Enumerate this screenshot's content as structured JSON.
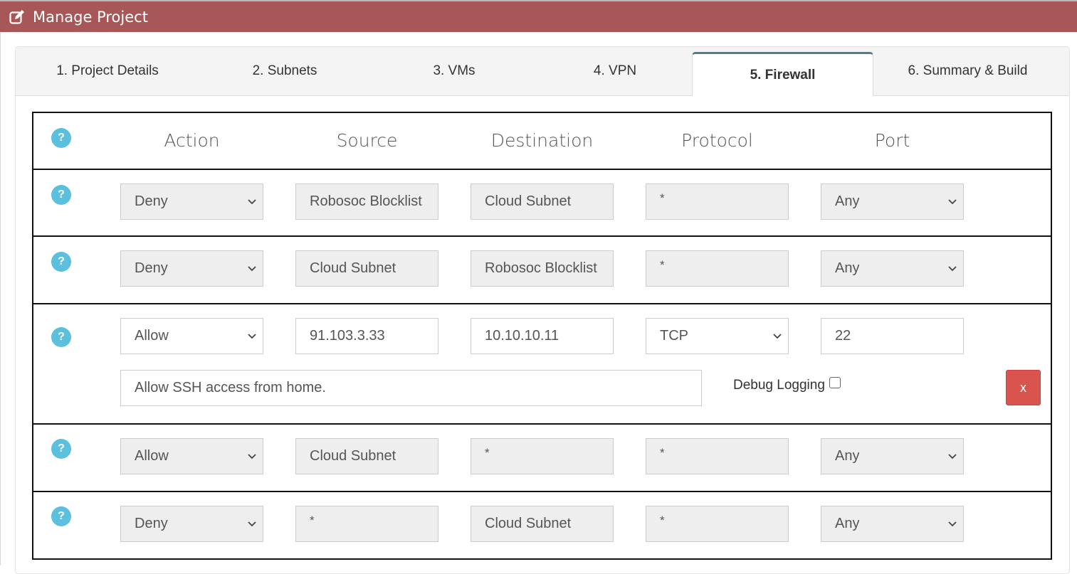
{
  "header": {
    "icon": "edit-icon",
    "title": "Manage Project"
  },
  "tabs": [
    {
      "label": "1. Project Details",
      "active": false
    },
    {
      "label": "2. Subnets",
      "active": false
    },
    {
      "label": "3. VMs",
      "active": false
    },
    {
      "label": "4. VPN",
      "active": false
    },
    {
      "label": "5. Firewall",
      "active": true
    },
    {
      "label": "6. Summary & Build",
      "active": false
    }
  ],
  "columns": [
    "Action",
    "Source",
    "Destination",
    "Protocol",
    "Port"
  ],
  "help_icon": "?",
  "rules": [
    {
      "action": "Deny",
      "source": "Robosoc Blocklist",
      "destination": "Cloud Subnet",
      "protocol": "*",
      "port": "Any",
      "editable": false
    },
    {
      "action": "Deny",
      "source": "Cloud Subnet",
      "destination": "Robosoc Blocklist",
      "protocol": "*",
      "port": "Any",
      "editable": false
    },
    {
      "action": "Allow",
      "source": "91.103.3.33",
      "destination": "10.10.10.11",
      "protocol": "TCP",
      "port": "22",
      "editable": true,
      "comment": "Allow SSH access from home.",
      "debug_label": "Debug Logging",
      "debug_checked": false,
      "delete_label": "x"
    },
    {
      "action": "Allow",
      "source": "Cloud Subnet",
      "destination": "*",
      "protocol": "*",
      "port": "Any",
      "editable": false
    },
    {
      "action": "Deny",
      "source": "*",
      "destination": "Cloud Subnet",
      "protocol": "*",
      "port": "Any",
      "editable": false
    }
  ],
  "colors": {
    "header": "#a75757",
    "help": "#5bc0de",
    "delete": "#d9534f",
    "active_tab_border": "#4f7b94"
  }
}
